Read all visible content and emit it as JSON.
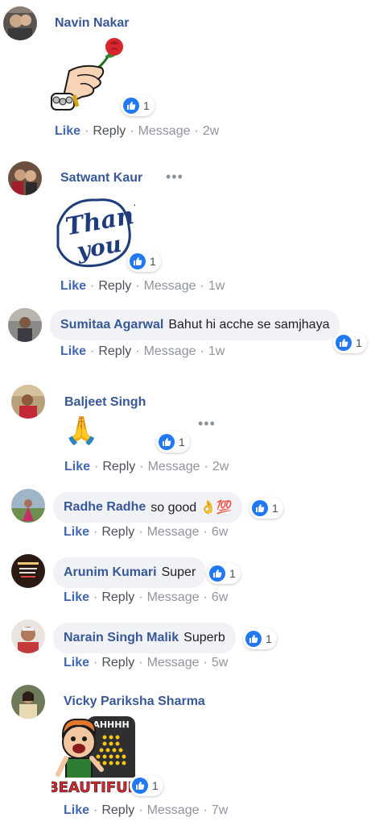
{
  "actions": {
    "like": "Like",
    "reply": "Reply",
    "message": "Message",
    "separator": "·"
  },
  "comments": [
    {
      "author": "Navin Nakar",
      "text": "",
      "sticker": "hand-with-rose",
      "reactions": "1",
      "time": "2w"
    },
    {
      "author": "Satwant Kaur",
      "text": "",
      "sticker": "thank-you",
      "reactions": "1",
      "time": "1w"
    },
    {
      "author": "Sumitaa Agarwal",
      "text": "Bahut hi acche se samjhaya",
      "reactions": "1",
      "time": "1w"
    },
    {
      "author": "Baljeet Singh",
      "text": "🙏",
      "reactions": "1",
      "time": "2w"
    },
    {
      "author": "Radhe Radhe",
      "text": "so good 👌💯",
      "reactions": "1",
      "time": "6w"
    },
    {
      "author": "Arunim Kumari",
      "text": "Super",
      "reactions": "1",
      "time": "6w"
    },
    {
      "author": "Narain Singh Malik",
      "text": "Superb",
      "reactions": "1",
      "time": "5w"
    },
    {
      "author": "Vicky Pariksha Sharma",
      "text": "",
      "sticker": "beautiful",
      "sticker_text": [
        "AHHHH",
        "BEAUTIFUL."
      ],
      "reactions": "1",
      "time": "7w"
    }
  ],
  "colors": {
    "name": "#385898",
    "like": "#4267b2",
    "bubble": "#f0f2f5",
    "reaction_blue": "#2078f4"
  }
}
